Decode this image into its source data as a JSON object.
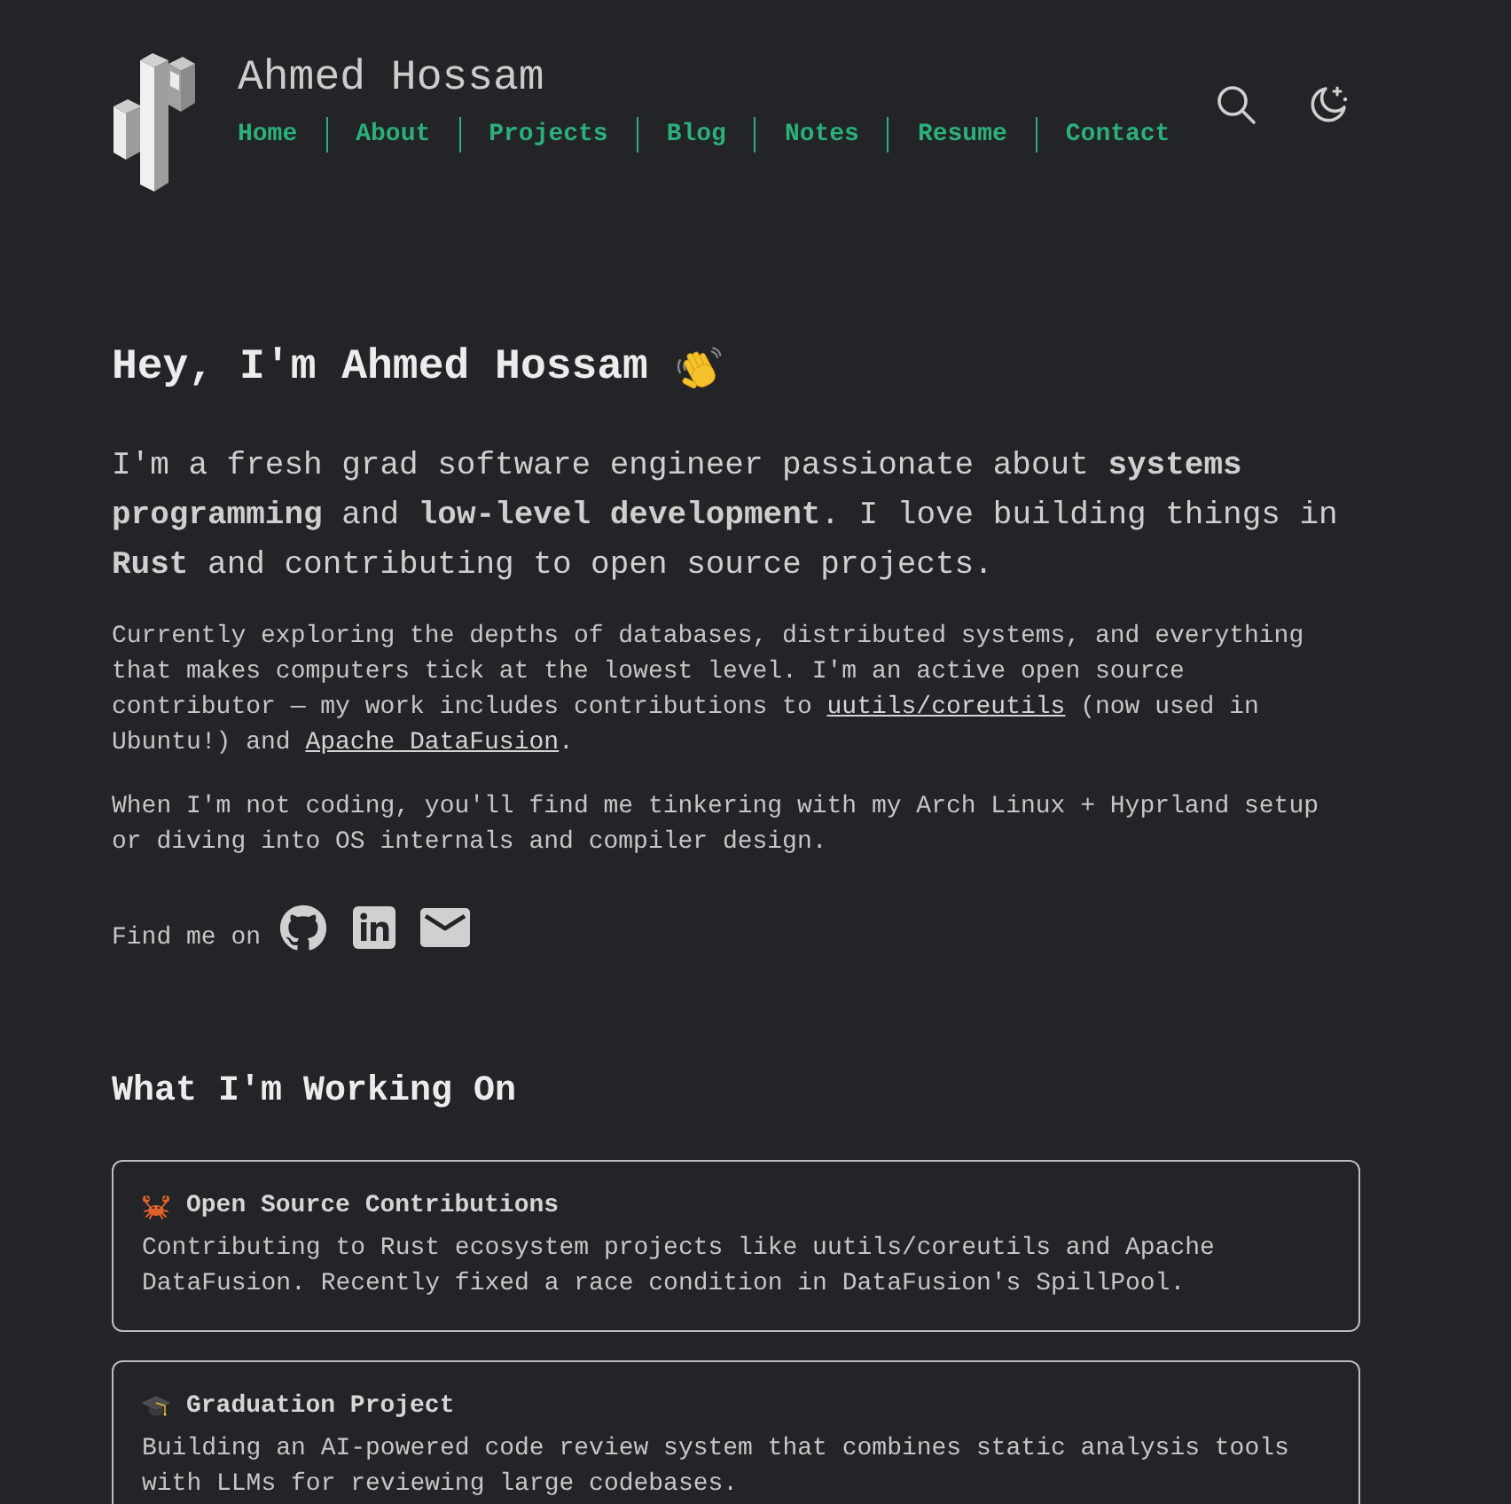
{
  "header": {
    "title": "Ahmed Hossam",
    "nav": [
      {
        "label": "Home"
      },
      {
        "label": "About"
      },
      {
        "label": "Projects"
      },
      {
        "label": "Blog"
      },
      {
        "label": "Notes"
      },
      {
        "label": "Resume"
      },
      {
        "label": "Contact"
      }
    ]
  },
  "hero": {
    "title": "Hey, I'm Ahmed Hossam",
    "intro": "I'm a fresh grad software engineer passionate about **systems programming** and **low-level development**. I love building things in **Rust** and contributing to open source projects.",
    "paragraphs": [
      {
        "segments": [
          {
            "kind": "text",
            "text": "Currently exploring the depths of databases, distributed systems, and everything that makes computers tick at the lowest level. I'm an active open source contributor — my work includes contributions to "
          },
          {
            "kind": "link",
            "text": "uutils/coreutils"
          },
          {
            "kind": "text",
            "text": " (now used in Ubuntu!) and "
          },
          {
            "kind": "link",
            "text": "Apache DataFusion"
          },
          {
            "kind": "text",
            "text": "."
          }
        ]
      },
      {
        "segments": [
          {
            "kind": "text",
            "text": "When I'm not coding, you'll find me tinkering with my Arch Linux + Hyprland setup or diving into OS internals and compiler design."
          }
        ]
      }
    ],
    "find_me": {
      "label": "Find me on",
      "links": [
        {
          "kind": "github"
        },
        {
          "kind": "linkedin"
        },
        {
          "kind": "email"
        }
      ]
    }
  },
  "working_on": {
    "title": "What I'm Working On",
    "cards": [
      {
        "kind": "open_source",
        "title": "Open Source Contributions",
        "description": "Contributing to Rust ecosystem projects like uutils/coreutils and Apache DataFusion. Recently fixed a race condition in DataFusion's SpillPool."
      },
      {
        "kind": "education",
        "title": "Graduation Project",
        "description": "Building an AI-powered code review system that combines static analysis tools with LLMs for reviewing large codebases."
      }
    ]
  }
}
